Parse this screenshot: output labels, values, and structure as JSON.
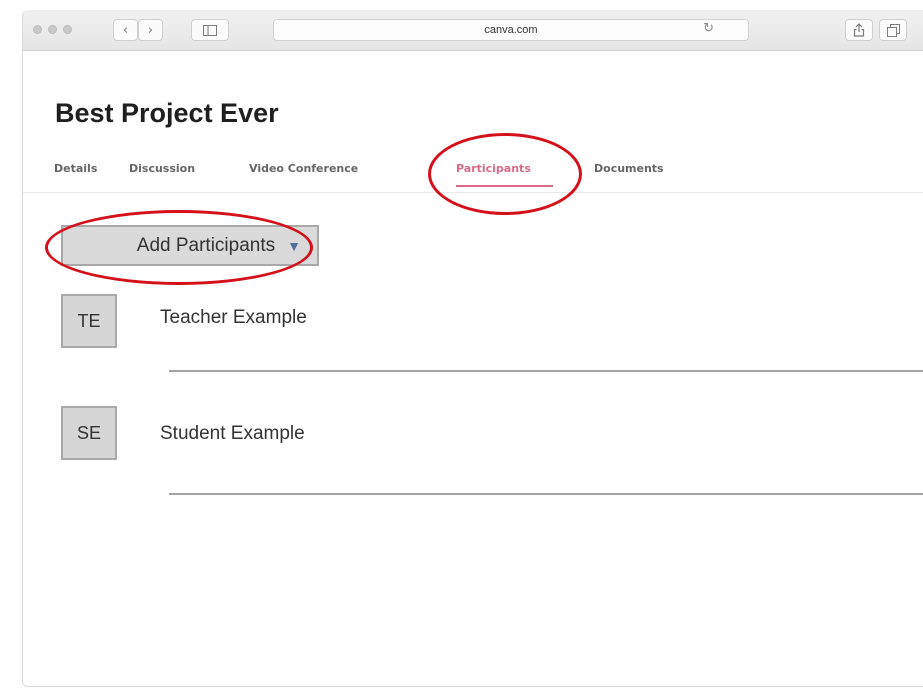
{
  "browser": {
    "url": "canva.com",
    "icons": {
      "back": "chevron-left-icon",
      "forward": "chevron-right-icon",
      "sidebar": "sidebar-icon",
      "reload": "reload-icon",
      "share": "share-icon",
      "tabs": "tabs-icon"
    }
  },
  "page": {
    "title": "Best Project Ever",
    "tabs": [
      {
        "label": "Details",
        "active": false
      },
      {
        "label": "Discussion",
        "active": false
      },
      {
        "label": "Video Conference",
        "active": false
      },
      {
        "label": "Participants",
        "active": true
      },
      {
        "label": "Documents",
        "active": false
      }
    ],
    "add_button_label": "Add Participants",
    "participants": [
      {
        "initials": "TE",
        "name": "Teacher Example"
      },
      {
        "initials": "SE",
        "name": "Student Example"
      }
    ]
  },
  "colors": {
    "accent": "#d96b88",
    "highlight_ring": "#d4101a"
  }
}
